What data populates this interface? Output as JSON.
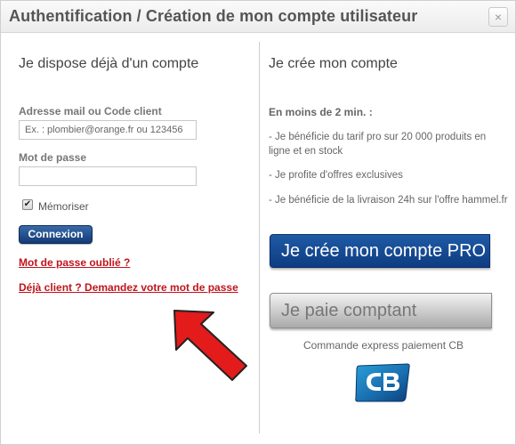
{
  "dialog": {
    "title": "Authentification / Création de mon compte utilisateur",
    "close_label": "×"
  },
  "login": {
    "heading": "Je dispose déjà d'un compte",
    "email_label": "Adresse mail ou Code client",
    "email_placeholder": "Ex. : plombier@orange.fr ou 123456",
    "email_value": "",
    "password_label": "Mot de passe",
    "password_value": "",
    "remember_label": "Mémoriser",
    "remember_checked": true,
    "submit_label": "Connexion",
    "forgot_link": "Mot de passe oublié ?",
    "request_link": "Déjà client ? Demandez votre mot de passe"
  },
  "signup": {
    "heading": "Je crée mon compte",
    "intro": "En moins de 2 min. :",
    "benefits": [
      "- Je bénéficie du tarif pro sur 20 000 produits en ligne et en stock",
      "- Je profite d'offres exclusives",
      "- Je bénéficie de la livraison 24h sur l'offre hammel.fr"
    ],
    "pro_button": "Je crée mon compte PRO",
    "cash_button": "Je paie comptant",
    "express_text": "Commande express paiement CB"
  },
  "icons": {
    "close": "close-icon",
    "check": "checkmark-icon",
    "cb_logo": "cb-card-logo",
    "arrow": "red-arrow"
  },
  "colors": {
    "link": "#c0151d",
    "primary_button": "#123a76",
    "arrow": "#e31b1b"
  }
}
